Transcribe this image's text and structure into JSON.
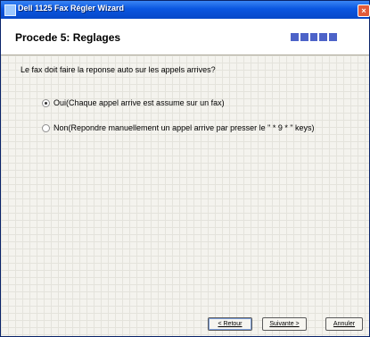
{
  "window": {
    "title": "Dell 1125 Fax Régler Wizard",
    "close_label": "×"
  },
  "header": {
    "step_title": "Procede 5: Reglages",
    "progress": {
      "segments": 5,
      "completed": 5,
      "color": "#4d63c8"
    }
  },
  "content": {
    "question": "Le fax doit faire la reponse auto sur les appels arrives?",
    "options": [
      {
        "label": "Oui(Chaque appel arrive est assume sur un fax)",
        "selected": true
      },
      {
        "label": "Non(Repondre manuellement un appel arrive par presser le  \" * 9 * \" keys)",
        "selected": false
      }
    ]
  },
  "buttons": {
    "back": "< Retour",
    "next": "Suivante >",
    "cancel": "Annuler"
  }
}
